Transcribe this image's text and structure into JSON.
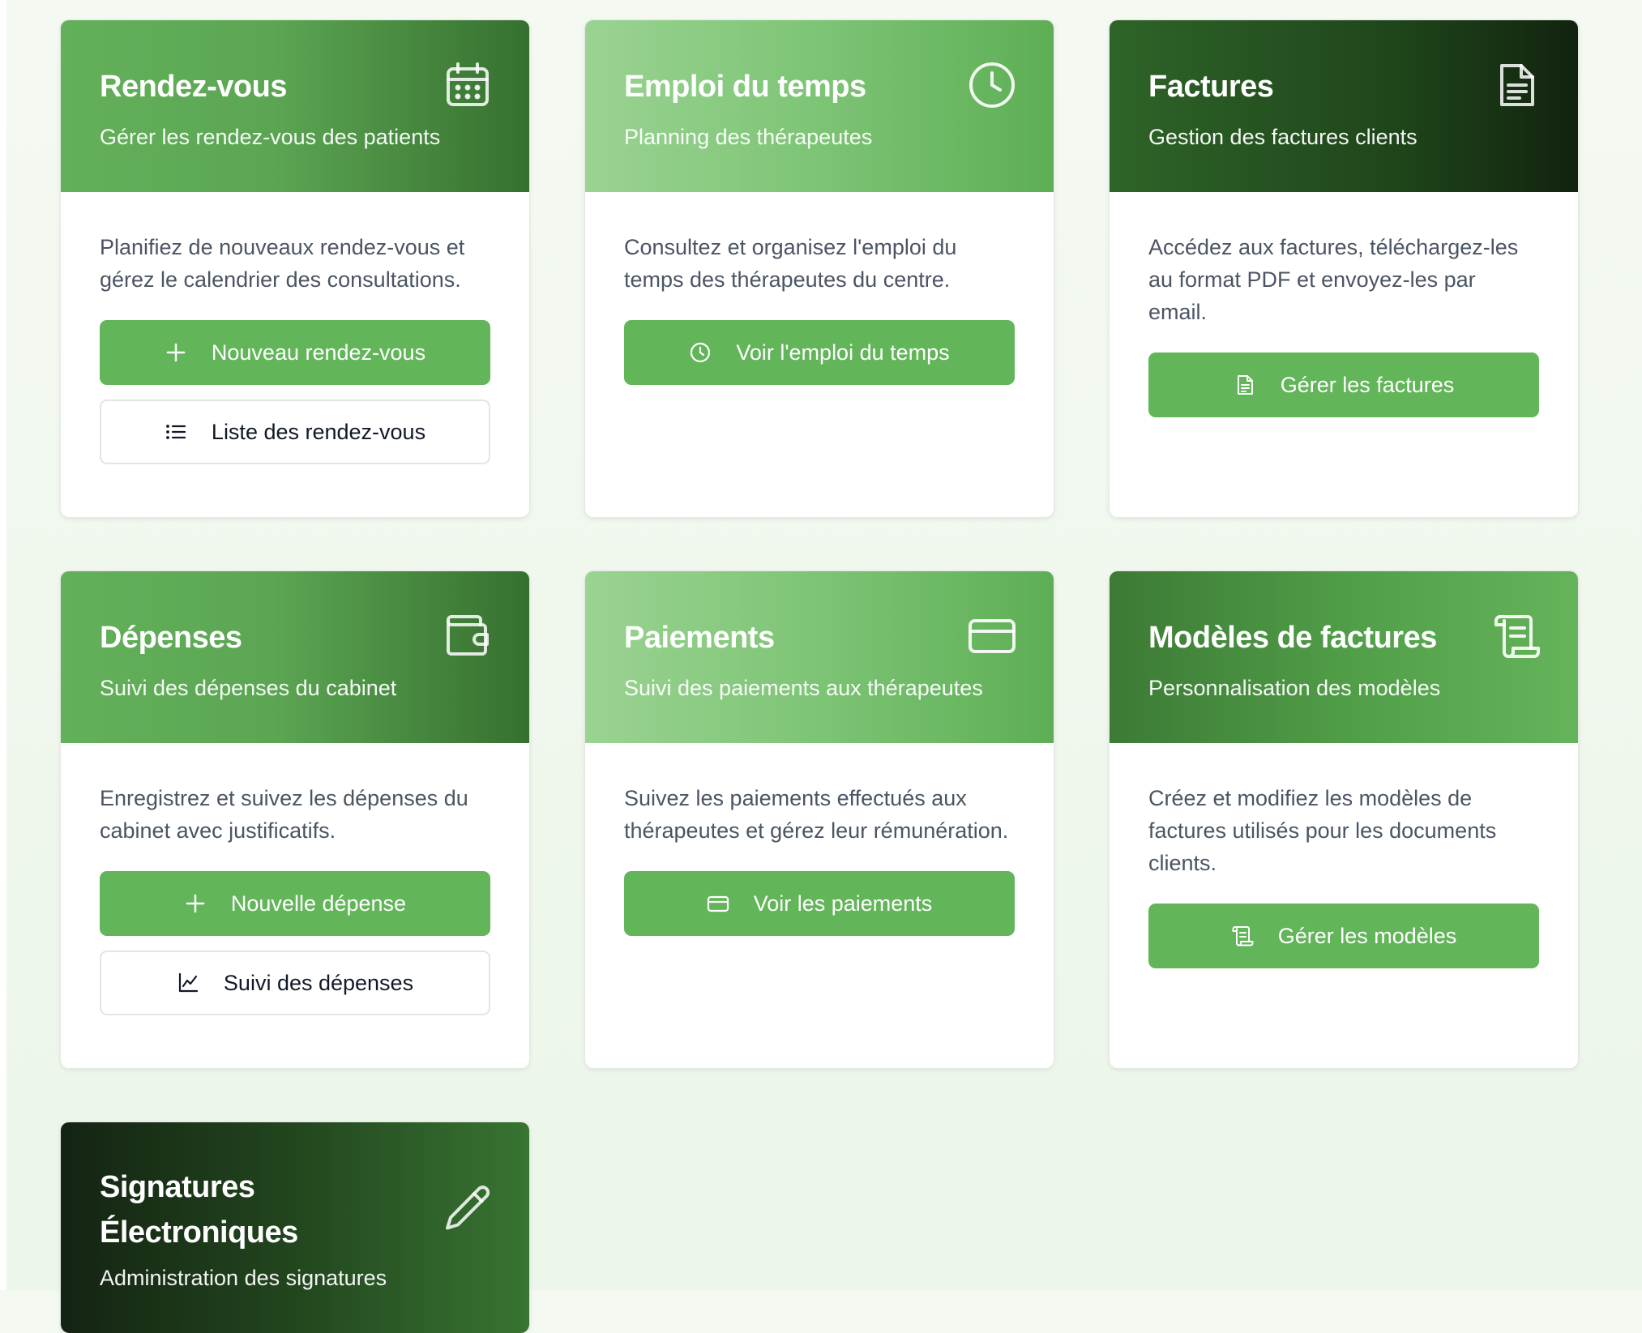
{
  "colors": {
    "accent": "#63b55a",
    "background": "#eef7ec"
  },
  "cards": [
    {
      "title": "Rendez-vous",
      "subtitle": "Gérer les rendez-vous des patients",
      "icon": "calendar-icon",
      "description": "Planifiez de nouveaux rendez-vous et gérez le calendrier des consultations.",
      "primary_button": {
        "label": "Nouveau rendez-vous",
        "icon": "plus-icon"
      },
      "secondary_button": {
        "label": "Liste des rendez-vous",
        "icon": "list-icon"
      }
    },
    {
      "title": "Emploi du temps",
      "subtitle": "Planning des thérapeutes",
      "icon": "clock-icon",
      "description": "Consultez et organisez l'emploi du temps des thérapeutes du centre.",
      "primary_button": {
        "label": "Voir l'emploi du temps",
        "icon": "clock-icon"
      }
    },
    {
      "title": "Factures",
      "subtitle": "Gestion des factures clients",
      "icon": "document-icon",
      "description": "Accédez aux factures, téléchargez-les au format PDF et envoyez-les par email.",
      "primary_button": {
        "label": "Gérer les factures",
        "icon": "document-icon"
      }
    },
    {
      "title": "Dépenses",
      "subtitle": "Suivi des dépenses du cabinet",
      "icon": "wallet-icon",
      "description": "Enregistrez et suivez les dépenses du cabinet avec justificatifs.",
      "primary_button": {
        "label": "Nouvelle dépense",
        "icon": "plus-icon"
      },
      "secondary_button": {
        "label": "Suivi des dépenses",
        "icon": "chart-line-icon"
      }
    },
    {
      "title": "Paiements",
      "subtitle": "Suivi des paiements aux thérapeutes",
      "icon": "credit-card-icon",
      "description": "Suivez les paiements effectués aux thérapeutes et gérez leur rémunération.",
      "primary_button": {
        "label": "Voir les paiements",
        "icon": "credit-card-icon"
      }
    },
    {
      "title": "Modèles de factures",
      "subtitle": "Personnalisation des modèles",
      "icon": "scroll-icon",
      "description": "Créez et modifiez les modèles de factures utilisés pour les documents clients.",
      "primary_button": {
        "label": "Gérer les modèles",
        "icon": "scroll-icon"
      }
    },
    {
      "title": "Signatures Électroniques",
      "subtitle": "Administration des signatures",
      "icon": "pencil-icon"
    }
  ]
}
